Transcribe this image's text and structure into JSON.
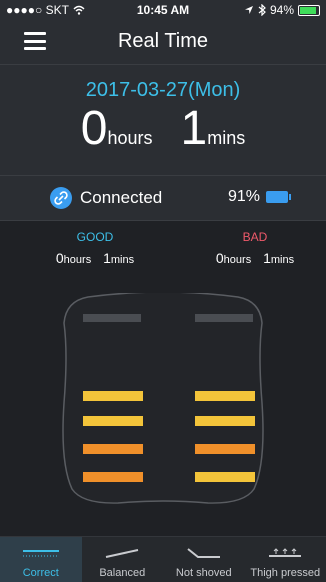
{
  "status_bar": {
    "carrier": "●●●●○ SKT",
    "time": "10:45 AM",
    "battery": "94%"
  },
  "nav": {
    "title": "Real Time"
  },
  "session": {
    "date": "2017-03-27(Mon)",
    "hours": "0",
    "hours_unit": "hours",
    "minutes": "1",
    "minutes_unit": "mins"
  },
  "device": {
    "status": "Connected",
    "battery_percent": "91%"
  },
  "good": {
    "label": "GOOD",
    "hours": "0",
    "hours_unit": "hours",
    "minutes": "1",
    "minutes_unit": "mins"
  },
  "bad": {
    "label": "BAD",
    "hours": "0",
    "hours_unit": "hours",
    "minutes": "1",
    "minutes_unit": "mins"
  },
  "colors": {
    "accent": "#3dbfe8",
    "bad": "#f05a6b",
    "bar_yellow": "#f3c43a",
    "bar_orange": "#f0902a",
    "bar_gray": "#4a4d52"
  },
  "tabs": [
    {
      "label": "Correct",
      "active": true
    },
    {
      "label": "Balanced",
      "active": false
    },
    {
      "label": "Not shoved",
      "active": false
    },
    {
      "label": "Thigh pressed",
      "active": false
    }
  ]
}
